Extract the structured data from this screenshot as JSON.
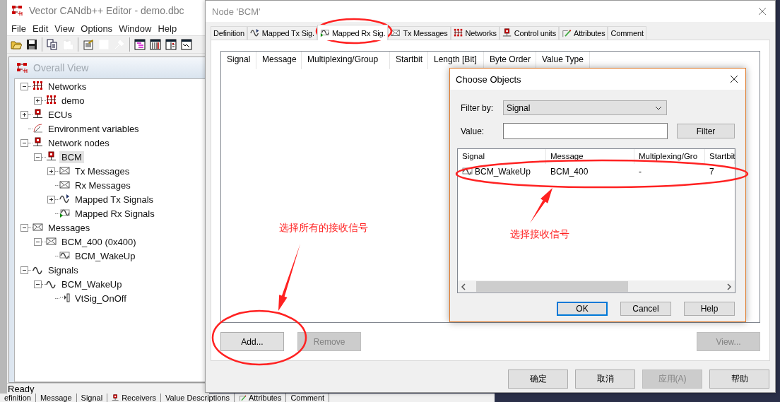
{
  "main_window": {
    "title": "Vector CANdb++ Editor - demo.dbc",
    "menu": [
      "File",
      "Edit",
      "View",
      "Options",
      "Window",
      "Help"
    ],
    "toolbar": [
      [
        {
          "kind": "open",
          "disabled": false
        },
        {
          "kind": "save",
          "disabled": false
        }
      ],
      [
        {
          "kind": "copy",
          "disabled": false
        },
        {
          "kind": "paste",
          "disabled": true
        }
      ],
      [
        {
          "kind": "notepad",
          "disabled": false
        },
        {
          "kind": "form",
          "disabled": true
        },
        {
          "kind": "tool",
          "disabled": true
        }
      ],
      [
        {
          "kind": "view-tree",
          "disabled": false
        },
        {
          "kind": "view-columns",
          "disabled": false
        },
        {
          "kind": "view-split",
          "disabled": false
        },
        {
          "kind": "view-chart",
          "disabled": false
        }
      ]
    ],
    "overall_view": {
      "title": "Overall View",
      "tree": [
        {
          "label": "Networks",
          "kind": "network",
          "expanded": true,
          "selected": false,
          "children": [
            {
              "label": "demo",
              "kind": "network",
              "expanded": false,
              "selected": false
            }
          ]
        },
        {
          "label": "ECUs",
          "kind": "ecu",
          "expanded": false,
          "selected": false
        },
        {
          "label": "Environment variables",
          "kind": "gauge",
          "selected": false
        },
        {
          "label": "Network nodes",
          "kind": "ecu",
          "expanded": true,
          "selected": false,
          "children": [
            {
              "label": "BCM",
              "kind": "ecu",
              "expanded": true,
              "selected": true,
              "children": [
                {
                  "label": "Tx Messages",
                  "kind": "message",
                  "expanded": false,
                  "selected": false
                },
                {
                  "label": "Rx Messages",
                  "kind": "message",
                  "selected": false
                },
                {
                  "label": "Mapped Tx Signals",
                  "kind": "mapped-tx",
                  "expanded": false,
                  "selected": false
                },
                {
                  "label": "Mapped Rx Signals",
                  "kind": "mapped-rx",
                  "selected": false
                }
              ]
            }
          ]
        },
        {
          "label": "Messages",
          "kind": "message",
          "expanded": true,
          "selected": false,
          "children": [
            {
              "label": "BCM_400 (0x400)",
              "kind": "message",
              "expanded": true,
              "selected": false,
              "children": [
                {
                  "label": "BCM_WakeUp",
                  "kind": "mapped",
                  "selected": false
                }
              ]
            }
          ]
        },
        {
          "label": "Signals",
          "kind": "wave",
          "expanded": true,
          "selected": false,
          "children": [
            {
              "label": "BCM_WakeUp",
              "kind": "wave",
              "expanded": true,
              "selected": false,
              "children": [
                {
                  "label": "VtSig_OnOff",
                  "kind": "value-table",
                  "selected": false
                }
              ]
            }
          ]
        }
      ]
    },
    "status_bar": "Ready"
  },
  "background_tabs": [
    {
      "label": "efinition",
      "kind": "plain"
    },
    {
      "label": "Message",
      "kind": "plain"
    },
    {
      "label": "Signal",
      "kind": "plain"
    },
    {
      "label": "Receivers",
      "kind": "ecu"
    },
    {
      "label": "Value Descriptions",
      "kind": "plain"
    },
    {
      "label": "Attributes",
      "kind": "pencil"
    },
    {
      "label": "Comment",
      "kind": "plain"
    }
  ],
  "node_dialog": {
    "title": "Node 'BCM'",
    "tabs": [
      {
        "label": "Definition",
        "kind": "plain",
        "selected": false
      },
      {
        "label": "Mapped Tx Sig.",
        "kind": "mapped-tx",
        "selected": false
      },
      {
        "label": "Mapped Rx Sig.",
        "kind": "mapped-rx",
        "selected": true
      },
      {
        "label": "Tx Messages",
        "kind": "message",
        "selected": false
      },
      {
        "label": "Networks",
        "kind": "network",
        "selected": false
      },
      {
        "label": "Control units",
        "kind": "ecu",
        "selected": false
      },
      {
        "label": "Attributes",
        "kind": "pencil",
        "selected": false
      },
      {
        "label": "Comment",
        "kind": "plain",
        "selected": false
      }
    ],
    "columns": [
      "Signal",
      "Message",
      "Multiplexing/Group",
      "Startbit",
      "Length [Bit]",
      "Byte Order",
      "Value Type"
    ],
    "buttons": [
      {
        "label": "Add...",
        "disabled": false
      },
      {
        "label": "Remove",
        "disabled": true
      },
      {
        "label": "View...",
        "disabled": true
      }
    ],
    "footer_buttons": [
      {
        "label": "确定",
        "disabled": false
      },
      {
        "label": "取消",
        "disabled": false
      },
      {
        "label": "应用(A)",
        "disabled": true
      },
      {
        "label": "帮助",
        "disabled": false
      }
    ]
  },
  "choose_dialog": {
    "title": "Choose Objects",
    "filter_label": "Filter by:",
    "filter_value": "Signal",
    "value_label": "Value:",
    "filter_button": "Filter",
    "columns": [
      "Signal",
      "Message",
      "Multiplexing/Gro",
      "Startbit"
    ],
    "rows": [
      {
        "kind": "mapped",
        "cells": [
          "BCM_WakeUp",
          "BCM_400",
          "-",
          "7"
        ]
      }
    ],
    "buttons": [
      {
        "label": "OK",
        "default": true
      },
      {
        "label": "Cancel",
        "default": false
      },
      {
        "label": "Help",
        "default": false
      }
    ]
  },
  "annotations": [
    {
      "text": "选择所有的接收信号"
    },
    {
      "text": "选择接收信号"
    }
  ]
}
